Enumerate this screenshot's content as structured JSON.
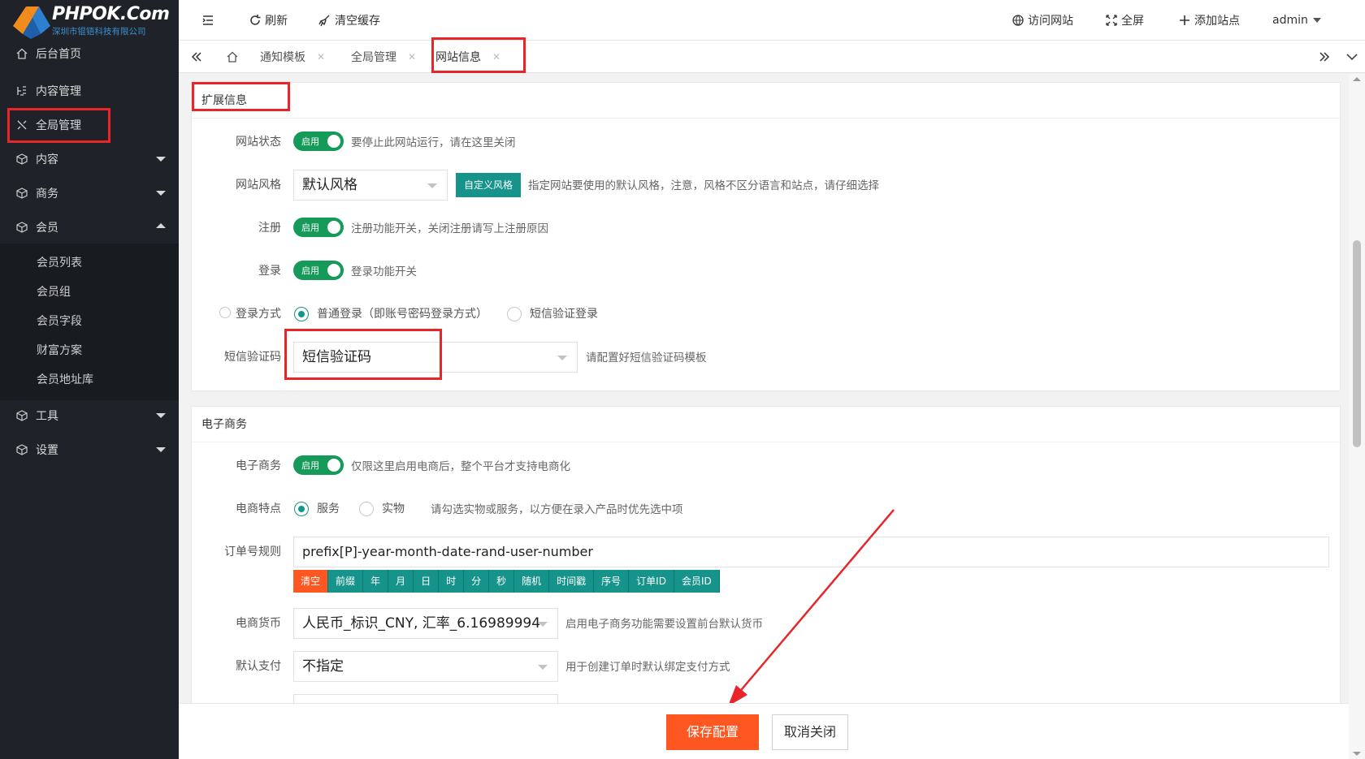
{
  "brand": {
    "name": "PHPOK.Com",
    "subtitle": "深圳市锟铻科技有限公司"
  },
  "sidebar": {
    "items": [
      {
        "label": "后台首页",
        "icon": "home-icon"
      },
      {
        "label": "内容管理",
        "icon": "content-icon"
      },
      {
        "label": "全局管理",
        "icon": "tools-icon"
      },
      {
        "label": "内容",
        "icon": "cube-icon"
      },
      {
        "label": "商务",
        "icon": "cube-icon"
      },
      {
        "label": "会员",
        "icon": "cube-icon"
      },
      {
        "label": "工具",
        "icon": "cube-icon"
      },
      {
        "label": "设置",
        "icon": "cube-icon"
      }
    ],
    "member_sub": [
      "会员列表",
      "会员组",
      "会员字段",
      "财富方案",
      "会员地址库"
    ]
  },
  "topbar": {
    "refresh": "刷新",
    "clear_cache": "清空缓存",
    "visit_site": "访问网站",
    "fullscreen": "全屏",
    "add_site": "添加站点",
    "user": "admin"
  },
  "tabs": [
    {
      "label": "通知模板"
    },
    {
      "label": "全局管理"
    },
    {
      "label": "网站信息"
    }
  ],
  "ext_section": {
    "title": "扩展信息",
    "site_status": {
      "label": "网站状态",
      "switch": "启用",
      "hint": "要停止此网站运行，请在这里关闭"
    },
    "site_style": {
      "label": "网站风格",
      "value": "默认风格",
      "button": "自定义风格",
      "hint": "指定网站要使用的默认风格，注意，风格不区分语言和站点，请仔细选择"
    },
    "register": {
      "label": "注册",
      "switch": "启用",
      "hint": "注册功能开关，关闭注册请写上注册原因"
    },
    "login": {
      "label": "登录",
      "switch": "启用",
      "hint": "登录功能开关"
    },
    "login_mode": {
      "label": "登录方式",
      "opt1": "普通登录（即账号密码登录方式）",
      "opt2": "短信验证登录"
    },
    "sms_code": {
      "label": "短信验证码",
      "value": "短信验证码",
      "hint": "请配置好短信验证码模板"
    }
  },
  "ecom_section": {
    "title": "电子商务",
    "ecommerce": {
      "label": "电子商务",
      "switch": "启用",
      "hint": "仅限这里启用电商后，整个平台才支持电商化"
    },
    "feature": {
      "label": "电商特点",
      "opt1": "服务",
      "opt2": "实物",
      "hint": "请勾选实物或服务，以方便在录入产品时优先选中项"
    },
    "order_rule": {
      "label": "订单号规则",
      "value": "prefix[P]-year-month-date-rand-user-number",
      "chips": [
        "清空",
        "前缀",
        "年",
        "月",
        "日",
        "时",
        "分",
        "秒",
        "随机",
        "时间戳",
        "序号",
        "订单ID",
        "会员ID"
      ]
    },
    "currency": {
      "label": "电商货币",
      "value": "人民币_标识_CNY, 汇率_6.16989994",
      "hint": "启用电子商务功能需要设置前台默认货币"
    },
    "payment": {
      "label": "默认支付",
      "value": "不指定",
      "hint": "用于创建订单时默认绑定支付方式"
    }
  },
  "footer": {
    "save": "保存配置",
    "cancel": "取消关闭"
  },
  "colors": {
    "accent": "#16938a",
    "save": "#ff5722",
    "sidebar": "#1f2329",
    "highlight": "#e8262a",
    "switch": "#159a5a"
  }
}
